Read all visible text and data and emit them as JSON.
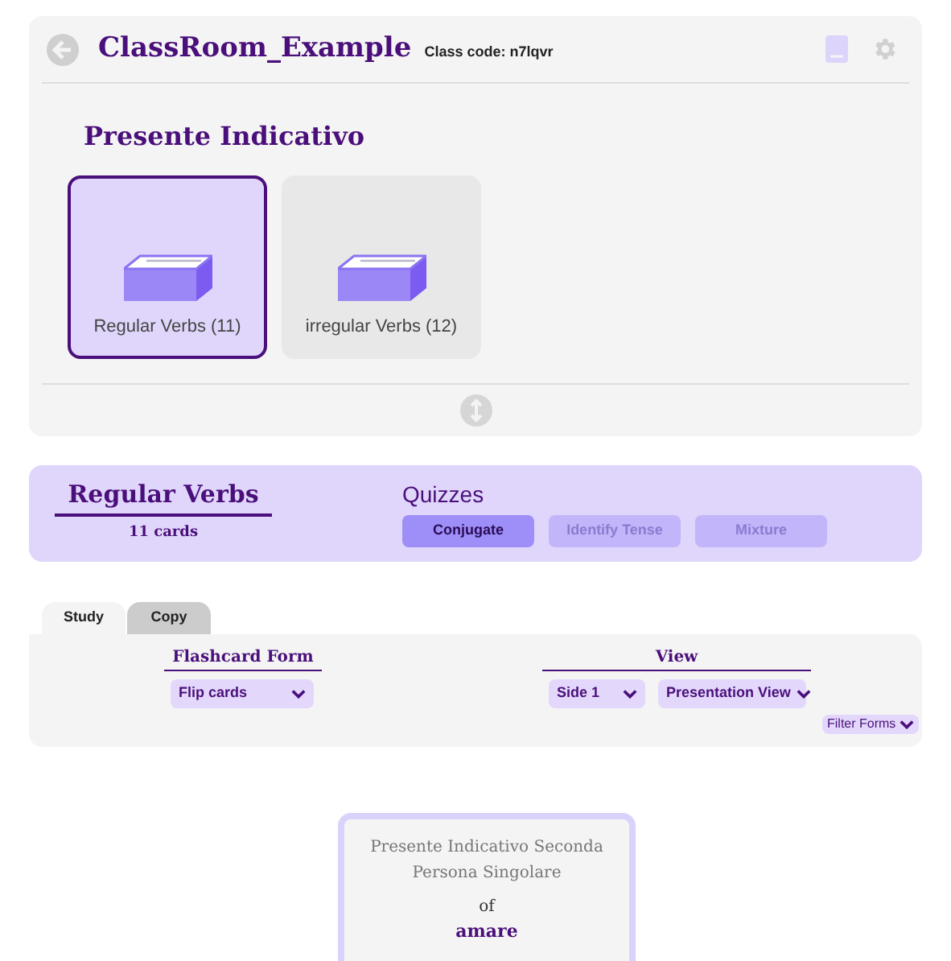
{
  "header": {
    "title": "ClassRoom_Example",
    "class_code": "Class code: n7lqvr"
  },
  "section_title": "Presente Indicativo",
  "decks": [
    {
      "label": "Regular Verbs (11)",
      "selected": true
    },
    {
      "label": "irregular Verbs (12)",
      "selected": false
    }
  ],
  "deck_panel": {
    "title": "Regular Verbs",
    "count": "11 cards",
    "quizzes_title": "Quizzes",
    "quizzes": [
      {
        "label": "Conjugate",
        "selected": true
      },
      {
        "label": "Identify Tense",
        "selected": false
      },
      {
        "label": "Mixture",
        "selected": false
      }
    ]
  },
  "tabs": [
    {
      "label": "Study",
      "selected": true
    },
    {
      "label": "Copy",
      "selected": false
    }
  ],
  "study": {
    "flashcard_form": {
      "title": "Flashcard Form",
      "value": "Flip cards"
    },
    "view": {
      "title": "View",
      "side": "Side 1",
      "mode": "Presentation View"
    },
    "filter_button": "Filter Forms"
  },
  "flashcard": {
    "prompt": "Presente Indicativo Seconda Persona Singolare",
    "connector": "of",
    "verb": "amare"
  }
}
